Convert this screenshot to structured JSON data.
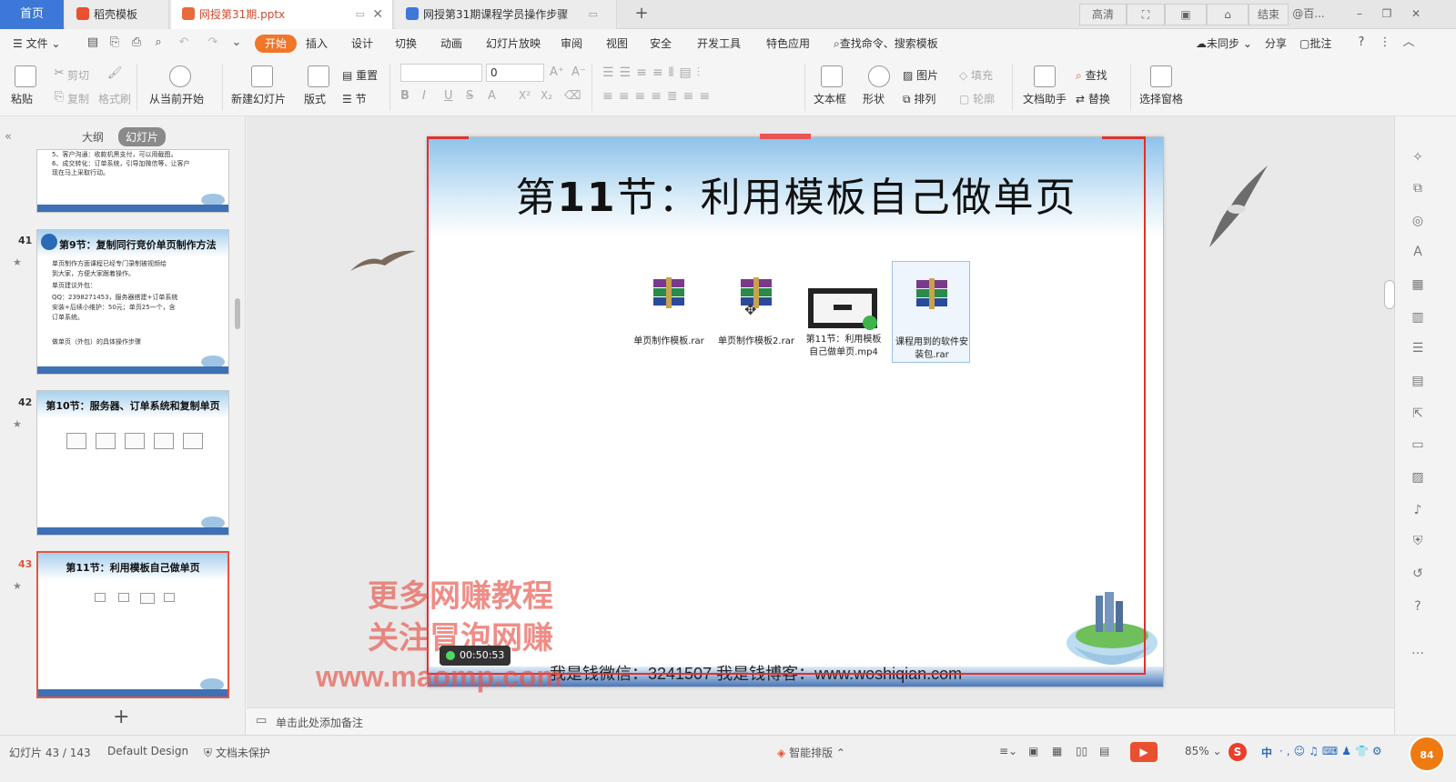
{
  "tabs": {
    "home": "首页",
    "items": [
      {
        "label": "稻壳模板",
        "color": "#e8502f"
      },
      {
        "label": "网授第31期.pptx",
        "color": "#e86a3a"
      },
      {
        "label": "网授第31期课程学员操作步骤",
        "color": "#3d78d8"
      }
    ]
  },
  "topright": {
    "hd": "高清",
    "end": "结束",
    "user": "@百..."
  },
  "menu": {
    "file": "文件",
    "items": [
      "开始",
      "插入",
      "设计",
      "切换",
      "动画",
      "幻灯片放映",
      "审阅",
      "视图",
      "安全",
      "开发工具",
      "特色应用"
    ],
    "search": "查找命令、搜索模板",
    "sync": "未同步",
    "share": "分享",
    "comment": "批注"
  },
  "ribbon": {
    "paste": "粘贴",
    "cut": "剪切",
    "copy": "复制",
    "format_painter": "格式刷",
    "from_current": "从当前开始",
    "new_slide": "新建幻灯片",
    "layout": "版式",
    "reset": "重置",
    "section": "节",
    "font_size": "0",
    "textbox": "文本框",
    "shape": "形状",
    "picture": "图片",
    "arrange": "排列",
    "fill": "填充",
    "outline": "轮廓",
    "doc_assistant": "文档助手",
    "find": "查找",
    "replace": "替换",
    "selection_pane": "选择窗格"
  },
  "leftpanel": {
    "outline_tab": "大纲",
    "slides_tab": "幻灯片",
    "slides": [
      {
        "num": "",
        "title": "",
        "lines": [
          "5、客户沟通：收款机黑支付，可以用截图。",
          "6、成交转化：订单系统，引导加微信等，让客户",
          "现在马上采取行动。"
        ]
      },
      {
        "num": "41",
        "title": "第9节：复制同行竞价单页制作方法",
        "lines": [
          "单页制作方面课程已经专门录制被视频给",
          "到大家，方便大家跟着操作。",
          "单页建议外包：",
          "QQ：2398271453，服务器搭建+订单系统",
          "安装+后续小维护：50元；单页25一个，含",
          "订单系统。",
          "做单页（外包）的具体操作步骤"
        ]
      },
      {
        "num": "42",
        "title": "第10节：服务器、订单系统和复制单页",
        "lines": []
      },
      {
        "num": "43",
        "title": "第11节：利用模板自己做单页",
        "lines": []
      }
    ],
    "thumb_footer": "我是钱微信：3241507  我是钱博客：www.woshiqian.com"
  },
  "slide": {
    "title_prefix": "第",
    "title_num": "11",
    "title_suffix": "节：利用模板自己做单页",
    "files": [
      {
        "label": "单页制作模板.rar",
        "type": "rar"
      },
      {
        "label": "单页制作模板2.rar",
        "type": "rar"
      },
      {
        "label": "第11节：利用模板自己做单页.mp4",
        "type": "video"
      },
      {
        "label": "课程用到的软件安装包.rar",
        "type": "rar"
      }
    ],
    "footer_text": "我是钱微信：3241507    我是钱博客：www.woshiqian.com"
  },
  "watermark": {
    "line1": "更多网赚教程",
    "line2": "关注冒泡网赚",
    "line3": "www.maomp.com"
  },
  "timer": "00:50:53",
  "notes": "单击此处添加备注",
  "status": {
    "slide_count": "幻灯片 43 / 143",
    "design": "Default Design",
    "protect": "文档未保护",
    "smart": "智能排版",
    "zoom": "85%",
    "ime": "中",
    "badge": "84"
  },
  "colors": {
    "accent": "#f0762a",
    "tab_blue": "#3d78d8",
    "selection_red": "#e5563d"
  }
}
